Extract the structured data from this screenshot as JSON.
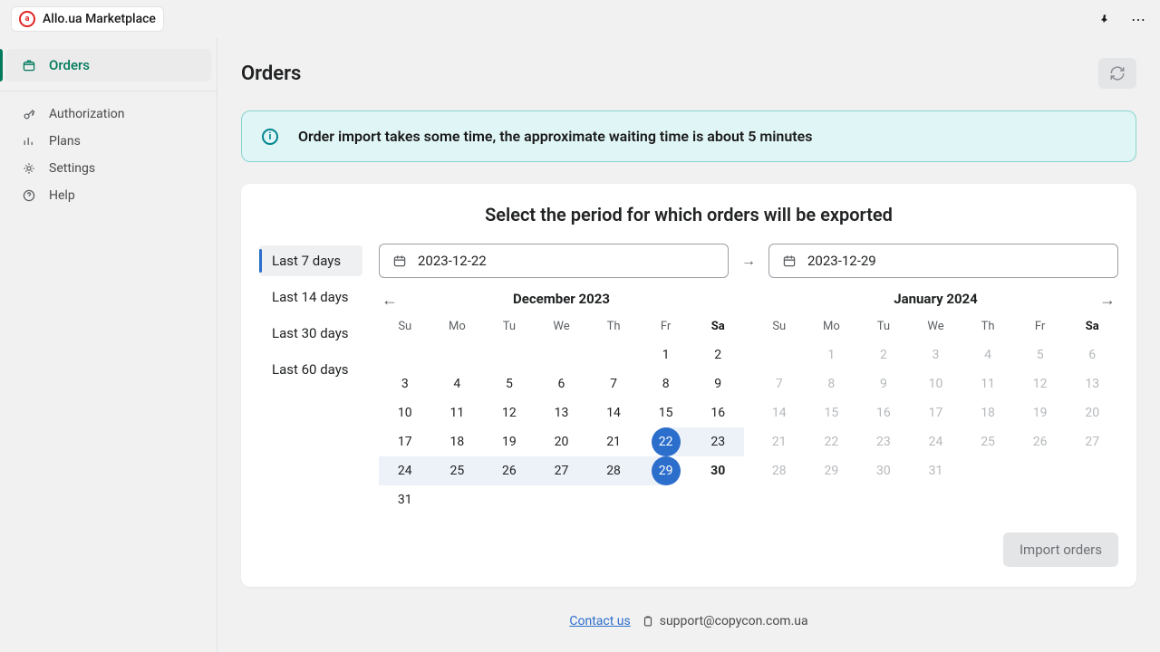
{
  "app": {
    "title": "Allo.ua Marketplace",
    "logo_letter": "a"
  },
  "sidebar": {
    "primary": {
      "label": "Orders"
    },
    "items": [
      {
        "label": "Authorization",
        "icon": "key-icon"
      },
      {
        "label": "Plans",
        "icon": "plans-icon"
      },
      {
        "label": "Settings",
        "icon": "gear-icon"
      },
      {
        "label": "Help",
        "icon": "help-icon"
      }
    ]
  },
  "page": {
    "title": "Orders"
  },
  "banner": {
    "text": "Order import takes some time, the approximate waiting time is about 5 minutes"
  },
  "card": {
    "title": "Select the period for which orders will be exported",
    "presets": [
      {
        "label": "Last 7 days",
        "active": true
      },
      {
        "label": "Last 14 days",
        "active": false
      },
      {
        "label": "Last 30 days",
        "active": false
      },
      {
        "label": "Last 60 days",
        "active": false
      }
    ],
    "date_from": "2023-12-22",
    "date_to": "2023-12-29",
    "calendars": {
      "dow": [
        "Su",
        "Mo",
        "Tu",
        "We",
        "Th",
        "Fr",
        "Sa"
      ],
      "dow_bold_index": 6,
      "left": {
        "title": "December 2023",
        "leading_blanks": 5,
        "days": 31,
        "trailing_out": [],
        "range_start": 22,
        "range_end": 29,
        "today": 30
      },
      "right": {
        "title": "January 2024",
        "leading_blanks": 1,
        "days": 31,
        "muted": true
      }
    },
    "import_label": "Import orders"
  },
  "footer": {
    "contact": "Contact us",
    "email": "support@copycon.com.ua"
  }
}
